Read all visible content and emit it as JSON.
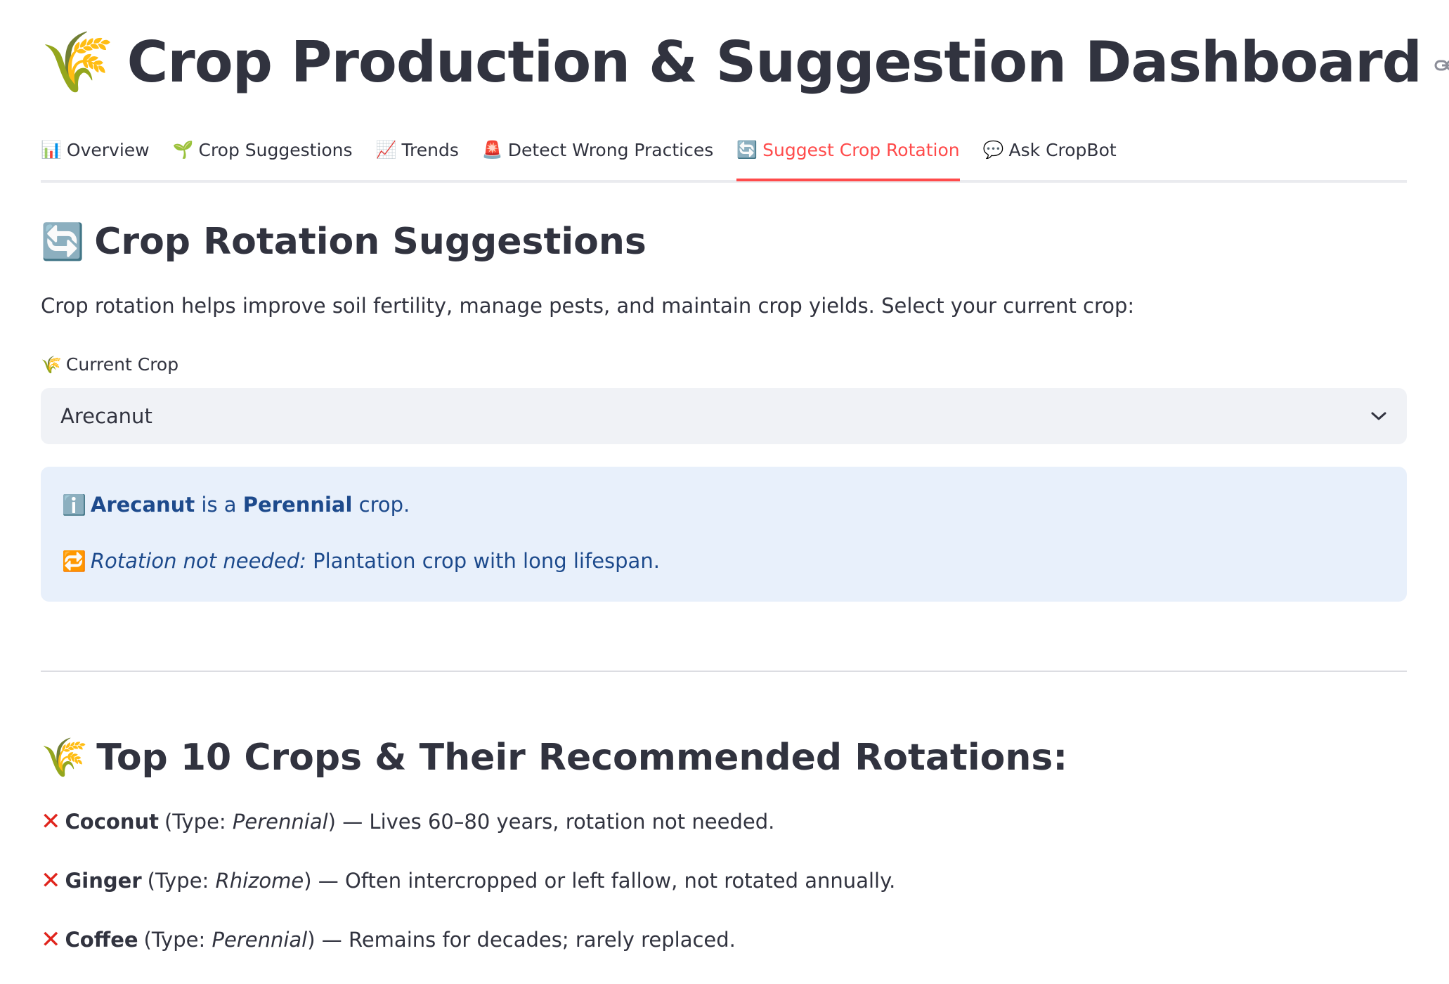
{
  "header": {
    "emoji": "🌾",
    "title": "Crop Production & Suggestion Dashboard"
  },
  "tabs": [
    {
      "emoji": "📊",
      "label": "Overview",
      "active": false
    },
    {
      "emoji": "🌱",
      "label": "Crop Suggestions",
      "active": false
    },
    {
      "emoji": "📈",
      "label": "Trends",
      "active": false
    },
    {
      "emoji": "🚨",
      "label": "Detect Wrong Practices",
      "active": false
    },
    {
      "emoji": "🔄",
      "label": "Suggest Crop Rotation",
      "active": true
    },
    {
      "emoji": "💬",
      "label": "Ask CropBot",
      "active": false
    }
  ],
  "section": {
    "emoji": "🔄",
    "title": "Crop Rotation Suggestions",
    "intro": "Crop rotation helps improve soil fertility, manage pests, and maintain crop yields. Select your current crop:"
  },
  "select": {
    "emoji": "🌾",
    "label": "Current Crop",
    "value": "Arecanut"
  },
  "info": {
    "line1": {
      "emoji": "ℹ️",
      "crop": "Arecanut",
      "text_a": " is a ",
      "type": "Perennial",
      "text_b": " crop."
    },
    "line2": {
      "emoji": "🔁",
      "label": "Rotation not needed:",
      "text": " Plantation crop with long lifespan."
    }
  },
  "top_list": {
    "emoji": "🌾",
    "title": "Top 10 Crops & Their Recommended Rotations:",
    "mark": "✕",
    "items": [
      {
        "name": "Coconut",
        "type_prefix": "(Type: ",
        "type": "Perennial",
        "type_suffix": ")",
        "note": " — Lives 60–80 years, rotation not needed."
      },
      {
        "name": "Ginger",
        "type_prefix": "(Type: ",
        "type": "Rhizome",
        "type_suffix": ")",
        "note": " — Often intercropped or left fallow, not rotated annually."
      },
      {
        "name": "Coffee",
        "type_prefix": "(Type: ",
        "type": "Perennial",
        "type_suffix": ")",
        "note": " — Remains for decades; rarely replaced."
      }
    ]
  },
  "colors": {
    "accent": "#ff4b4b",
    "info_bg": "#e8f0fb",
    "info_text": "#1d4a8c",
    "select_bg": "#f0f2f6",
    "text": "#31333f",
    "x_mark": "#e0241c"
  }
}
